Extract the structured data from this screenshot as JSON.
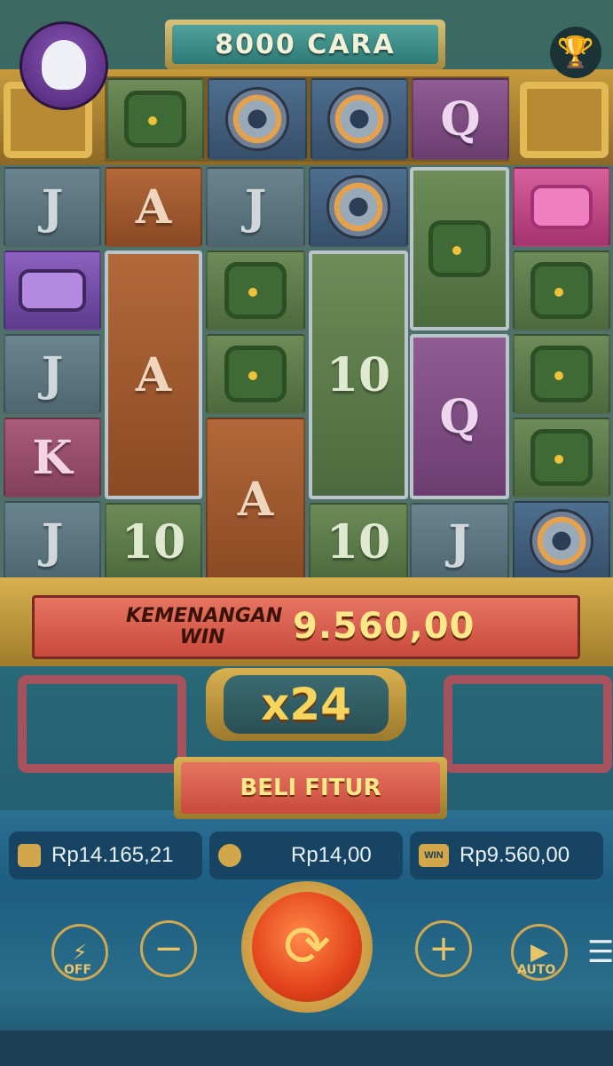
{
  "header": {
    "ways_text": "8000 CARA",
    "avatar_icon": "ghost-avatar-icon",
    "trophy_icon": "trophy-icon"
  },
  "reels": {
    "top_row": [
      "mask",
      "wheel",
      "wheel",
      "Q"
    ],
    "cells": {
      "r1c1": "J",
      "r1c2": "A",
      "r1c3": "J",
      "r3c1": "J",
      "r4c1": "K",
      "r5c1": "J",
      "tall_a1": "A",
      "tall_10": "10",
      "tall_q": "Q",
      "tall_a2": "A",
      "r5c2": "10",
      "r5c4": "10",
      "r5c5": "J"
    }
  },
  "win": {
    "label_line1": "KEMENANGAN",
    "label_line2": "WIN",
    "amount": "9.560,00"
  },
  "multiplier": "x24",
  "buy_feature_label": "BELI FITUR",
  "bottom_bar": {
    "balance": "Rp14.165,21",
    "bet": "Rp14,00",
    "win": "Rp9.560,00",
    "win_icon_text": "WIN"
  },
  "controls": {
    "turbo_label": "OFF",
    "minus": "−",
    "plus": "+",
    "auto_label": "AUTO",
    "menu": "☰"
  },
  "colors": {
    "accent_gold": "#d8b04f",
    "win_red": "#d8594a",
    "panel_blue": "#1e5d82"
  }
}
